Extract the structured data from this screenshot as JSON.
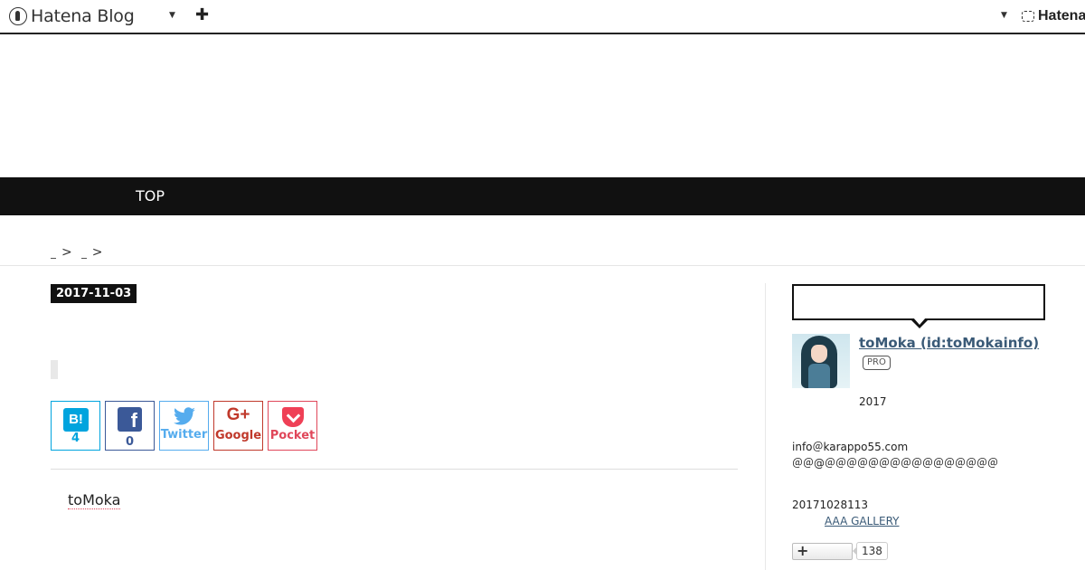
{
  "global_header": {
    "brand": "Hatena Blog",
    "right_brand": "Hatena",
    "icons": {
      "logo": "hatena-blog-logo-icon",
      "add": "plus-icon",
      "menu": "caret-down-icon"
    }
  },
  "nav": {
    "items": [
      {
        "label": "TOP"
      }
    ]
  },
  "breadcrumb": {
    "separators": [
      ">",
      ">"
    ]
  },
  "entry": {
    "date": "2017-11-03",
    "author_text": "toMoka"
  },
  "share": {
    "hatena": {
      "icon": "B!",
      "count": "4"
    },
    "facebook": {
      "icon": "f",
      "count": "0"
    },
    "twitter": {
      "label": "Twitter"
    },
    "google": {
      "icon": "G+",
      "label": "Google"
    },
    "pocket": {
      "label": "Pocket"
    }
  },
  "sidebar": {
    "profile_name": "toMoka (id:toMokainfo)",
    "badge": "PRO",
    "year": "2017",
    "email": "info＠karappo55.com",
    "contact": "＠＠@＠＠＠＠＠＠＠＠＠＠＠＠＠＠＠＠",
    "number_line": "20171028113",
    "gallery_link": "AAA GALLERY",
    "subscribe_icon": "+",
    "subscriber_count": "138"
  },
  "colors": {
    "hatena_bookmark": "#00a4de",
    "facebook": "#3b5998",
    "twitter": "#55acee",
    "google_plus": "#c0392b",
    "pocket": "#e0475a",
    "nav_bg": "#111111",
    "link": "#3a5a77"
  }
}
